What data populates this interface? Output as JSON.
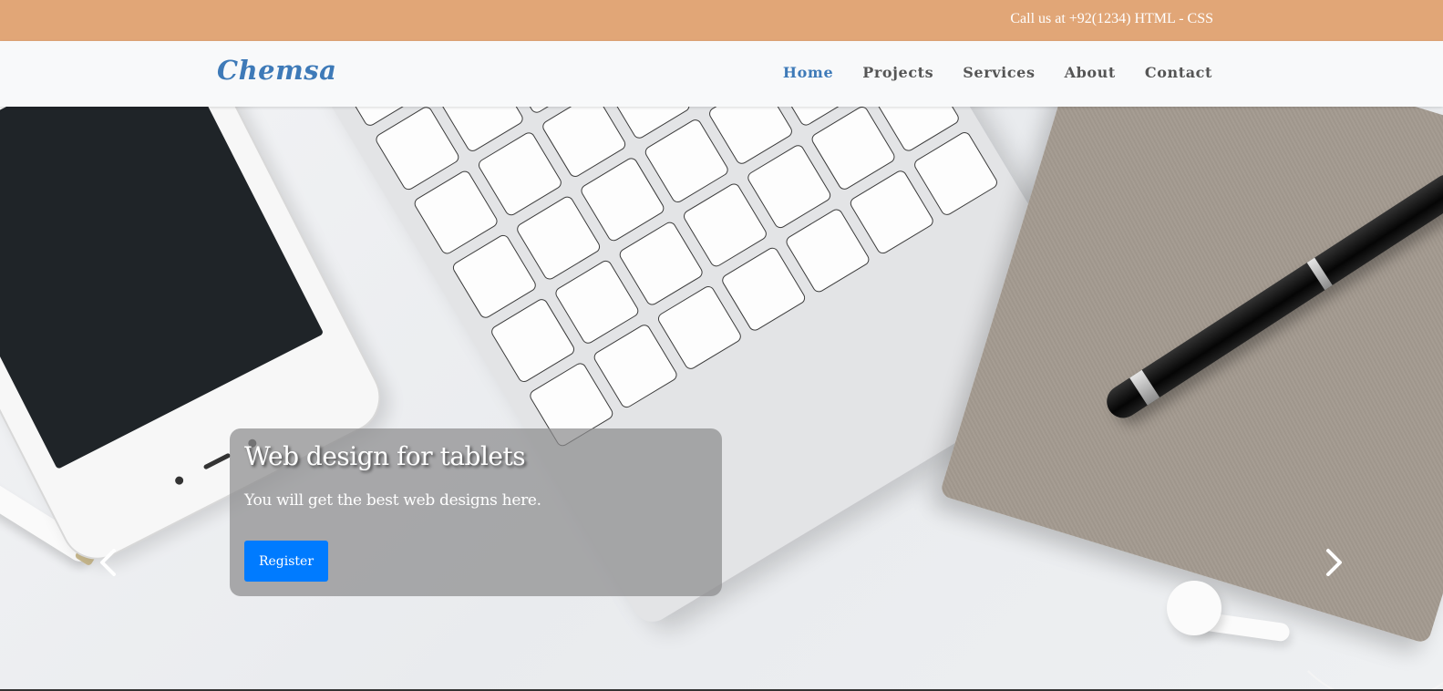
{
  "topbar": {
    "text": "Call us at +92(1234) HTML - CSS"
  },
  "brand": {
    "logo": "Chemsa",
    "color": "#3e7ab8"
  },
  "nav": {
    "items": [
      {
        "label": "Home",
        "active": true
      },
      {
        "label": "Projects",
        "active": false
      },
      {
        "label": "Services",
        "active": false
      },
      {
        "label": "About",
        "active": false
      },
      {
        "label": "Contact",
        "active": false
      }
    ]
  },
  "hero": {
    "title": "Web design for tablets",
    "text": "You will get the best web designs here.",
    "button_label": "Register",
    "prev_icon": "chevron-left-icon",
    "next_icon": "chevron-right-icon"
  },
  "colors": {
    "topbar": "#e1a677",
    "button": "#007bff",
    "nav_active": "#3e7ab8"
  }
}
